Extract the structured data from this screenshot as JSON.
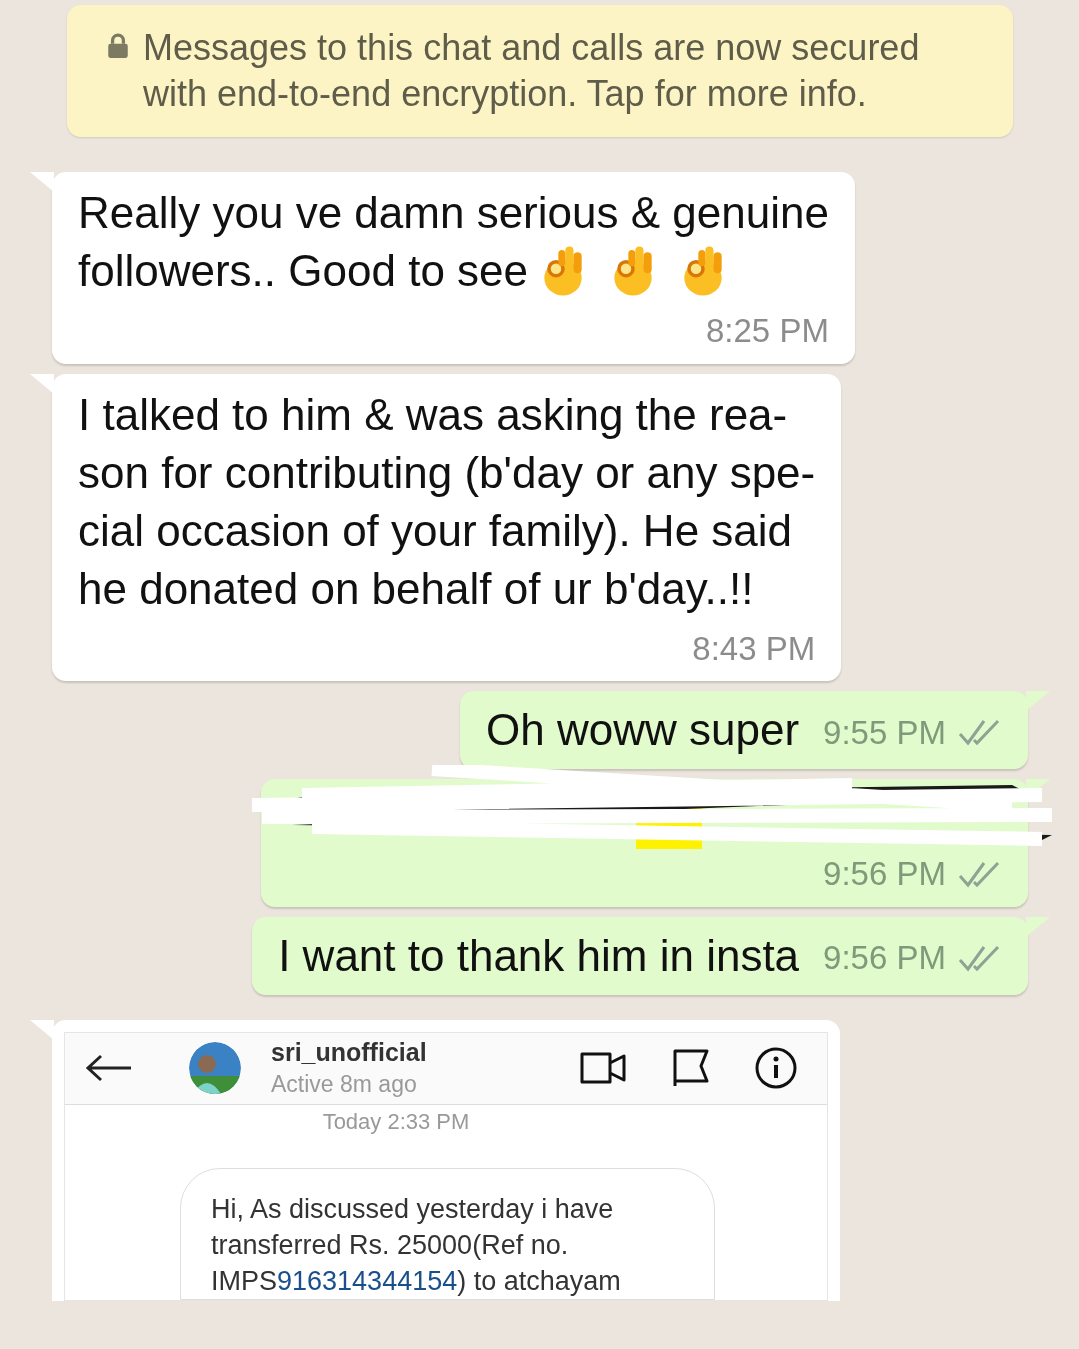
{
  "encryption_notice": {
    "text": "Messages to this chat and calls are now secured with end-to-end encryption. Tap for more info."
  },
  "messages": [
    {
      "kind": "text",
      "outgoing": false,
      "lines": [
        "Really you ve damn serious & genuine",
        "followers.. Good to see"
      ],
      "emojis": [
        {
          "kind": "ok-hand"
        },
        {
          "kind": "ok-hand"
        },
        {
          "kind": "ok-hand"
        }
      ],
      "time": "8:25 PM"
    },
    {
      "kind": "text",
      "outgoing": false,
      "lines": [
        "I talked to him & was asking the rea-",
        "son for contributing (b'day or any spe-",
        "cial occasion of your family). He said",
        "he donated on behalf of ur b'day..!!"
      ],
      "time": "8:43 PM"
    },
    {
      "kind": "text",
      "outgoing": true,
      "lines": [
        "Oh woww super"
      ],
      "time": "9:55 PM",
      "read": false
    },
    {
      "kind": "redacted",
      "outgoing": true,
      "time": "9:56 PM",
      "read": false
    },
    {
      "kind": "text",
      "outgoing": true,
      "lines": [
        "I want to thank him in insta"
      ],
      "time": "9:56 PM",
      "read": false
    },
    {
      "kind": "screenshot",
      "outgoing": false,
      "screenshot": {
        "username": "sri_unofficial",
        "activity": "Active 8m ago",
        "date": "Today 2:33 PM",
        "message": {
          "lines": [
            "Hi, As discussed yesterday i have",
            "transferred Rs. 25000(Ref no."
          ],
          "last_line_before": "IMPS",
          "link": "916314344154",
          "last_line_after": ") to atchayam"
        }
      }
    }
  ]
}
